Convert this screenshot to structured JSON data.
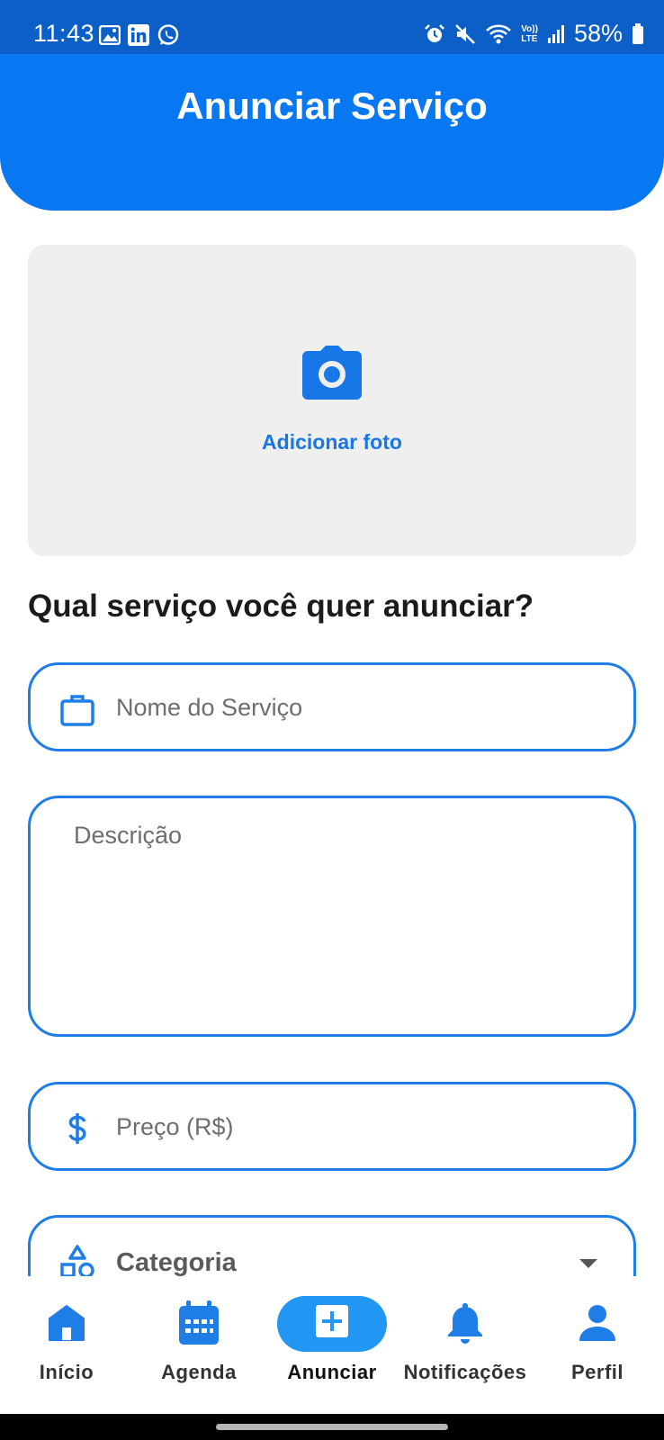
{
  "status_bar": {
    "time": "11:43",
    "battery": "58%",
    "left_icons": [
      "gallery-icon",
      "linkedin-icon",
      "whatsapp-icon"
    ],
    "right_icons": [
      "alarm-icon",
      "mute-icon",
      "wifi-icon",
      "volte-icon",
      "signal-icon",
      "battery-icon"
    ],
    "volte_text_1": "Vo))",
    "volte_text_2": "LTE"
  },
  "header": {
    "title": "Anunciar Serviço"
  },
  "photo": {
    "label": "Adicionar foto",
    "icon": "camera-icon"
  },
  "form": {
    "question": "Qual serviço você quer anunciar?",
    "service_name": {
      "placeholder": "Nome do Serviço",
      "value": "",
      "icon": "briefcase-icon"
    },
    "description": {
      "placeholder": "Descrição",
      "value": ""
    },
    "price": {
      "placeholder": "Preço (R$)",
      "value": "",
      "icon": "dollar-icon"
    },
    "category": {
      "label": "Categoria",
      "icon": "category-icon"
    }
  },
  "bottom_nav": {
    "items": [
      {
        "label": "Início",
        "icon": "home-icon"
      },
      {
        "label": "Agenda",
        "icon": "calendar-icon"
      },
      {
        "label": "Anunciar",
        "icon": "add-box-icon",
        "active": true
      },
      {
        "label": "Notificações",
        "icon": "bell-icon"
      },
      {
        "label": "Perfil",
        "icon": "person-icon"
      }
    ]
  },
  "colors": {
    "status_bar": "#0b5fc7",
    "header": "#0878f2",
    "accent": "#1f7de6",
    "active_pill": "#2196f3",
    "photo_bg": "#efefef"
  }
}
